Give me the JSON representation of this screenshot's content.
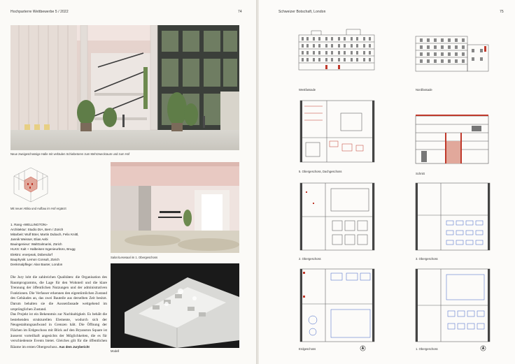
{
  "left_page": {
    "header_left": "Hochparterre Wettbewerbe 5 / 2022",
    "page_number": "74",
    "captions": {
      "hall": "Neue zweigeschossige Halle mit verläulen Schiebetoren zum Mehrzweckraum und zum Hof",
      "axo": "Mit neuer Attika und Aufbau im Hof ergänzt",
      "salon": "Salon/Lesesaal im 1. Obergeschoss",
      "model": "Modell"
    },
    "credits": [
      "1. Rang «WELLINGTON»",
      "Architektur: Studio DIA, Bern / Zürich",
      "Mitarbeit: Wulf Böer, Martin Dubach, Felix Knittl,",
      "Jannik Weisser, Elias Aebi",
      "Bauingenieur: WaltGalmarini, Zürich",
      "HLKS: Kalt + Halbeisen Ingenieurbüro, Brugg",
      "Elektro: enerpeak, Dübendorf",
      "Bauphysik: Lemon Consult, Zürich",
      "Denkmalpflege: Alan Baxter, London"
    ],
    "jury_text": [
      "Die Jury lobt die zahlreichen Qualitäten: die Organisation des Raumprogramms, die Lage für den Wohnteil und die klare Trennung der öffentlichen Nutzungen und der administrativen Funktionen. Die Verfasser erkennen den eigentümlichen Zustand des Gebäudes an, das zwei Bauteile aus derselben Zeit besitzt. Darum behalten sie die Aussenfassade weitgehend im ursprünglichen Zustand.",
      "Das Projekt ist ein Bekenntnis zur Nachhaltigkeit. Es behält die bestehenden strukturellen Elemente, wodurch sich der Neugestaltungsaufwand in Grenzen hält. Die Öffnung der Flächen im Erdgeschoss mit Blick auf den Bryanston Square ist äusserst vorteilhaft angesichts der Möglichkeiten, die es für verschiedenste Events bietet. Gleiches gilt für die öffentlichen Räume im ersten Obergeschoss."
    ],
    "jury_source": "Aus dem Jurybericht"
  },
  "right_page": {
    "header_left": "Schweizer Botschaft, London",
    "page_number": "75",
    "drawings": {
      "west": "Westfassade",
      "north": "Nordfassade",
      "og5": "5. Obergeschoss, Dachgeschoss",
      "section": "Schnitt",
      "og2": "2. Obergeschoss",
      "og3": "3. Obergeschoss",
      "eg": "Erdgeschoss",
      "og1": "1. Obergeschoss"
    }
  },
  "colors": {
    "page": "#fbfaf7",
    "text": "#222222",
    "pink_plaster": "#e8c9c2",
    "plant_green": "#5f7d48",
    "drawing_red": "#c0392b"
  }
}
